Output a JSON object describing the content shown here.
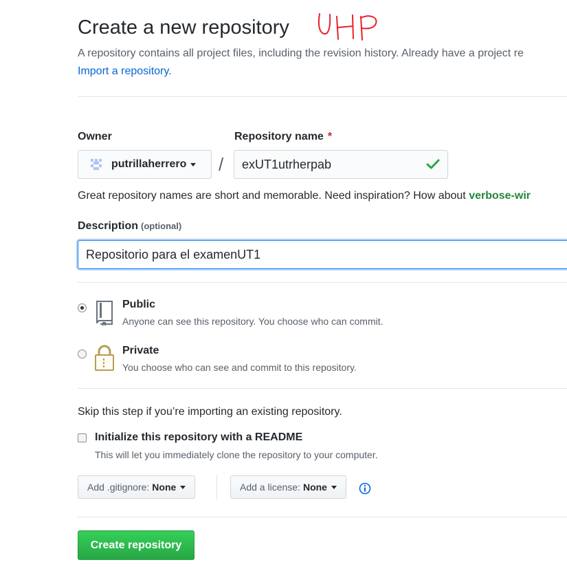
{
  "header": {
    "title": "Create a new repository",
    "annotation": "UHP",
    "subtitle": "A repository contains all project files, including the revision history. Already have a project re",
    "import_link": "Import a repository."
  },
  "owner": {
    "label": "Owner",
    "value": "putrillaherrero",
    "avatar_icon": "identicon-avatar"
  },
  "repo_name": {
    "label": "Repository name",
    "required_mark": "*",
    "value": "exUT1utrherpab",
    "separator": "/",
    "valid_icon": "check-icon"
  },
  "hint": {
    "text": "Great repository names are short and memorable. Need inspiration? How about",
    "suggestion": "verbose-wir"
  },
  "description": {
    "label": "Description",
    "optional": "(optional)",
    "value": "Repositorio para el examenUT1"
  },
  "visibility": {
    "options": [
      {
        "title": "Public",
        "desc": "Anyone can see this repository. You choose who can commit.",
        "checked": true,
        "icon": "repo-book-icon"
      },
      {
        "title": "Private",
        "desc": "You choose who can see and commit to this repository.",
        "checked": false,
        "icon": "lock-icon"
      }
    ]
  },
  "init": {
    "skip_text": "Skip this step if you’re importing an existing repository.",
    "checkbox_label": "Initialize this repository with a README",
    "checkbox_desc": "This will let you immediately clone the repository to your computer.",
    "checked": false
  },
  "gitignore": {
    "label": "Add .gitignore:",
    "value": "None"
  },
  "license": {
    "label": "Add a license:",
    "value": "None"
  },
  "submit": {
    "label": "Create repository"
  },
  "colors": {
    "primary_green": "#28a745",
    "link_blue": "#0366d6",
    "required_red": "#cb2431",
    "annotation_red": "#e8202a"
  }
}
